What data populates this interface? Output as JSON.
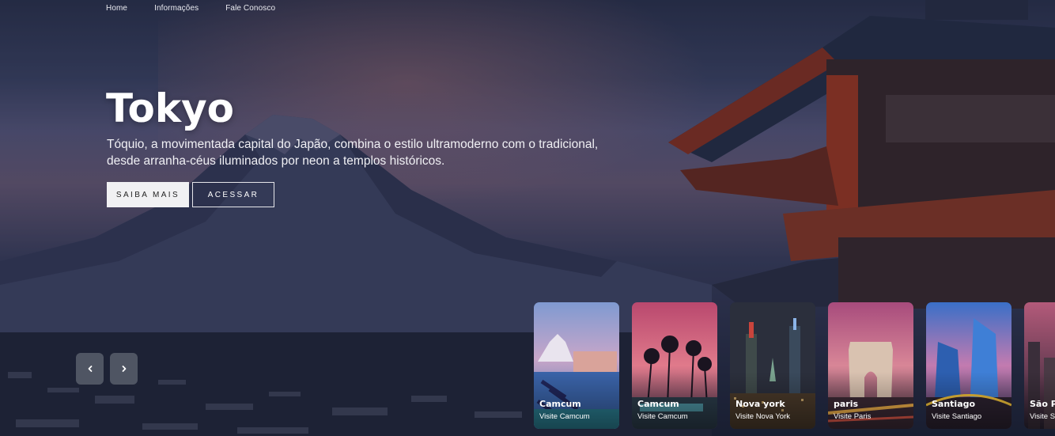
{
  "nav": {
    "items": [
      {
        "label": "Home"
      },
      {
        "label": "Informações"
      },
      {
        "label": "Fale Conosco"
      }
    ]
  },
  "hero": {
    "title": "Tokyo",
    "description_line1": "Tóquio, a movimentada capital do Japão, combina o estilo ultramoderno com o tradicional,",
    "description_line2": "desde arranha-céus iluminados por neon a templos históricos.",
    "primary_button": "SAIBA MAIS",
    "secondary_button": "ACESSAR"
  },
  "carousel": {
    "prev_icon": "chevron-left-icon",
    "next_icon": "chevron-right-icon",
    "cards": [
      {
        "title": "Camcum",
        "subtitle": "Visite Camcum"
      },
      {
        "title": "Camcum",
        "subtitle": "Visite Camcum"
      },
      {
        "title": "Nova york",
        "subtitle": "Visite Nova York"
      },
      {
        "title": "paris",
        "subtitle": "Visite Paris"
      },
      {
        "title": "Santiago",
        "subtitle": "Visite Santiago"
      },
      {
        "title": "São Paulo",
        "subtitle": "Visite São Paulo"
      }
    ]
  },
  "colors": {
    "button_primary_bg": "#f1f1f3",
    "button_secondary_border": "#e6e6ea",
    "text": "#ffffff"
  }
}
